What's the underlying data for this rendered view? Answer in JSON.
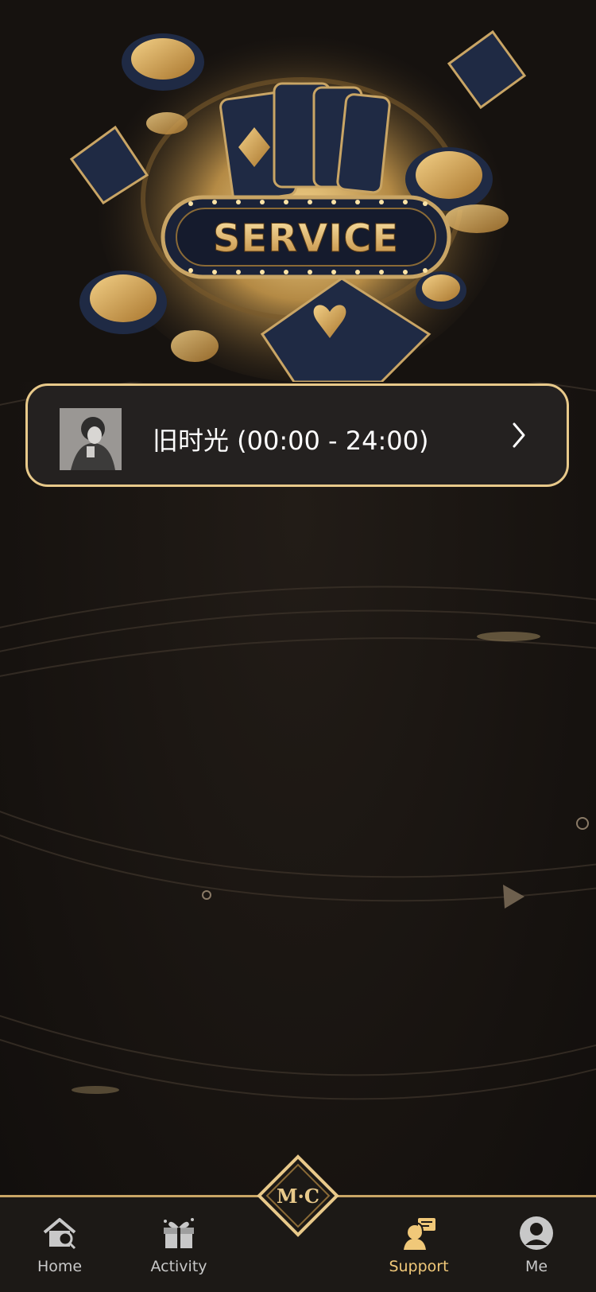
{
  "hero": {
    "banner_text": "SERVICE"
  },
  "service_list": [
    {
      "label": "旧时光 (00:00 - 24:00)"
    }
  ],
  "logo": {
    "text": "M·C"
  },
  "bottom_nav": {
    "items": [
      {
        "label": "Home",
        "icon": "home-icon",
        "active": false
      },
      {
        "label": "Activity",
        "icon": "gift-icon",
        "active": false
      },
      {
        "label": "Support",
        "icon": "support-agent-icon",
        "active": true
      },
      {
        "label": "Me",
        "icon": "user-profile-icon",
        "active": false
      }
    ]
  },
  "colors": {
    "accent_gold": "#e8c98a",
    "background": "#1a1613",
    "card_background": "#242120",
    "active_nav": "#f0c879",
    "inactive_nav": "#c8c8c8"
  }
}
